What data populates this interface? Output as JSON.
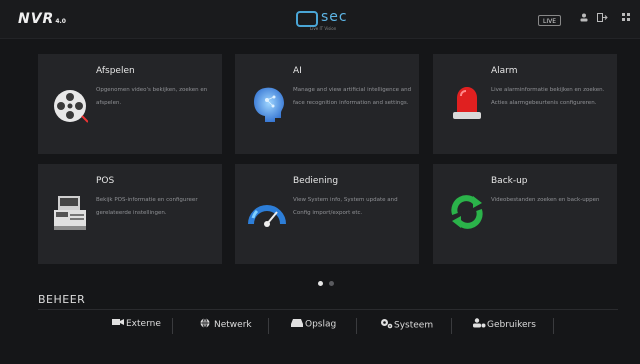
{
  "header": {
    "logo": "NVR",
    "logo_version": "4.0",
    "brand_name": "sec",
    "brand_tagline": "Live IT Vision",
    "live_label": "LIVE",
    "user_icon": "user-icon",
    "logout_icon": "logout-icon",
    "grid_icon": "grid-icon"
  },
  "cards": [
    {
      "title": "Afspelen",
      "desc": "Opgenomen video's bekijken, zoeken en afspelen.",
      "icon": "film-reel-icon"
    },
    {
      "title": "AI",
      "desc": "Manage and view artificial intelligence and face recognition information and settings.",
      "icon": "ai-head-icon"
    },
    {
      "title": "Alarm",
      "desc": "Live alarminformatie bekijken en zoeken. Acties alarmgebeurtenis configureren.",
      "icon": "alarm-siren-icon"
    },
    {
      "title": "POS",
      "desc": "Bekijk POS-informatie en configureer gerelateerde instellingen.",
      "icon": "pos-terminal-icon"
    },
    {
      "title": "Bediening",
      "desc": "View System info, System update and Config import/export etc.",
      "icon": "gauge-icon"
    },
    {
      "title": "Back-up",
      "desc": "Videobestanden zoeken en back-uppen",
      "icon": "backup-sync-icon"
    }
  ],
  "pagination": {
    "current": 1,
    "total": 2
  },
  "management": {
    "title": "BEHEER",
    "items": [
      {
        "label": "Externe",
        "icon": "camera-icon"
      },
      {
        "label": "Netwerk",
        "icon": "network-globe-icon"
      },
      {
        "label": "Opslag",
        "icon": "storage-icon"
      },
      {
        "label": "Systeem",
        "icon": "settings-gears-icon"
      },
      {
        "label": "Gebruikers",
        "icon": "users-icon"
      }
    ]
  },
  "colors": {
    "background": "#151618",
    "card": "#242528",
    "brand_blue": "#5db5e5",
    "alarm_red": "#e02020",
    "backup_green": "#2bb34a"
  }
}
